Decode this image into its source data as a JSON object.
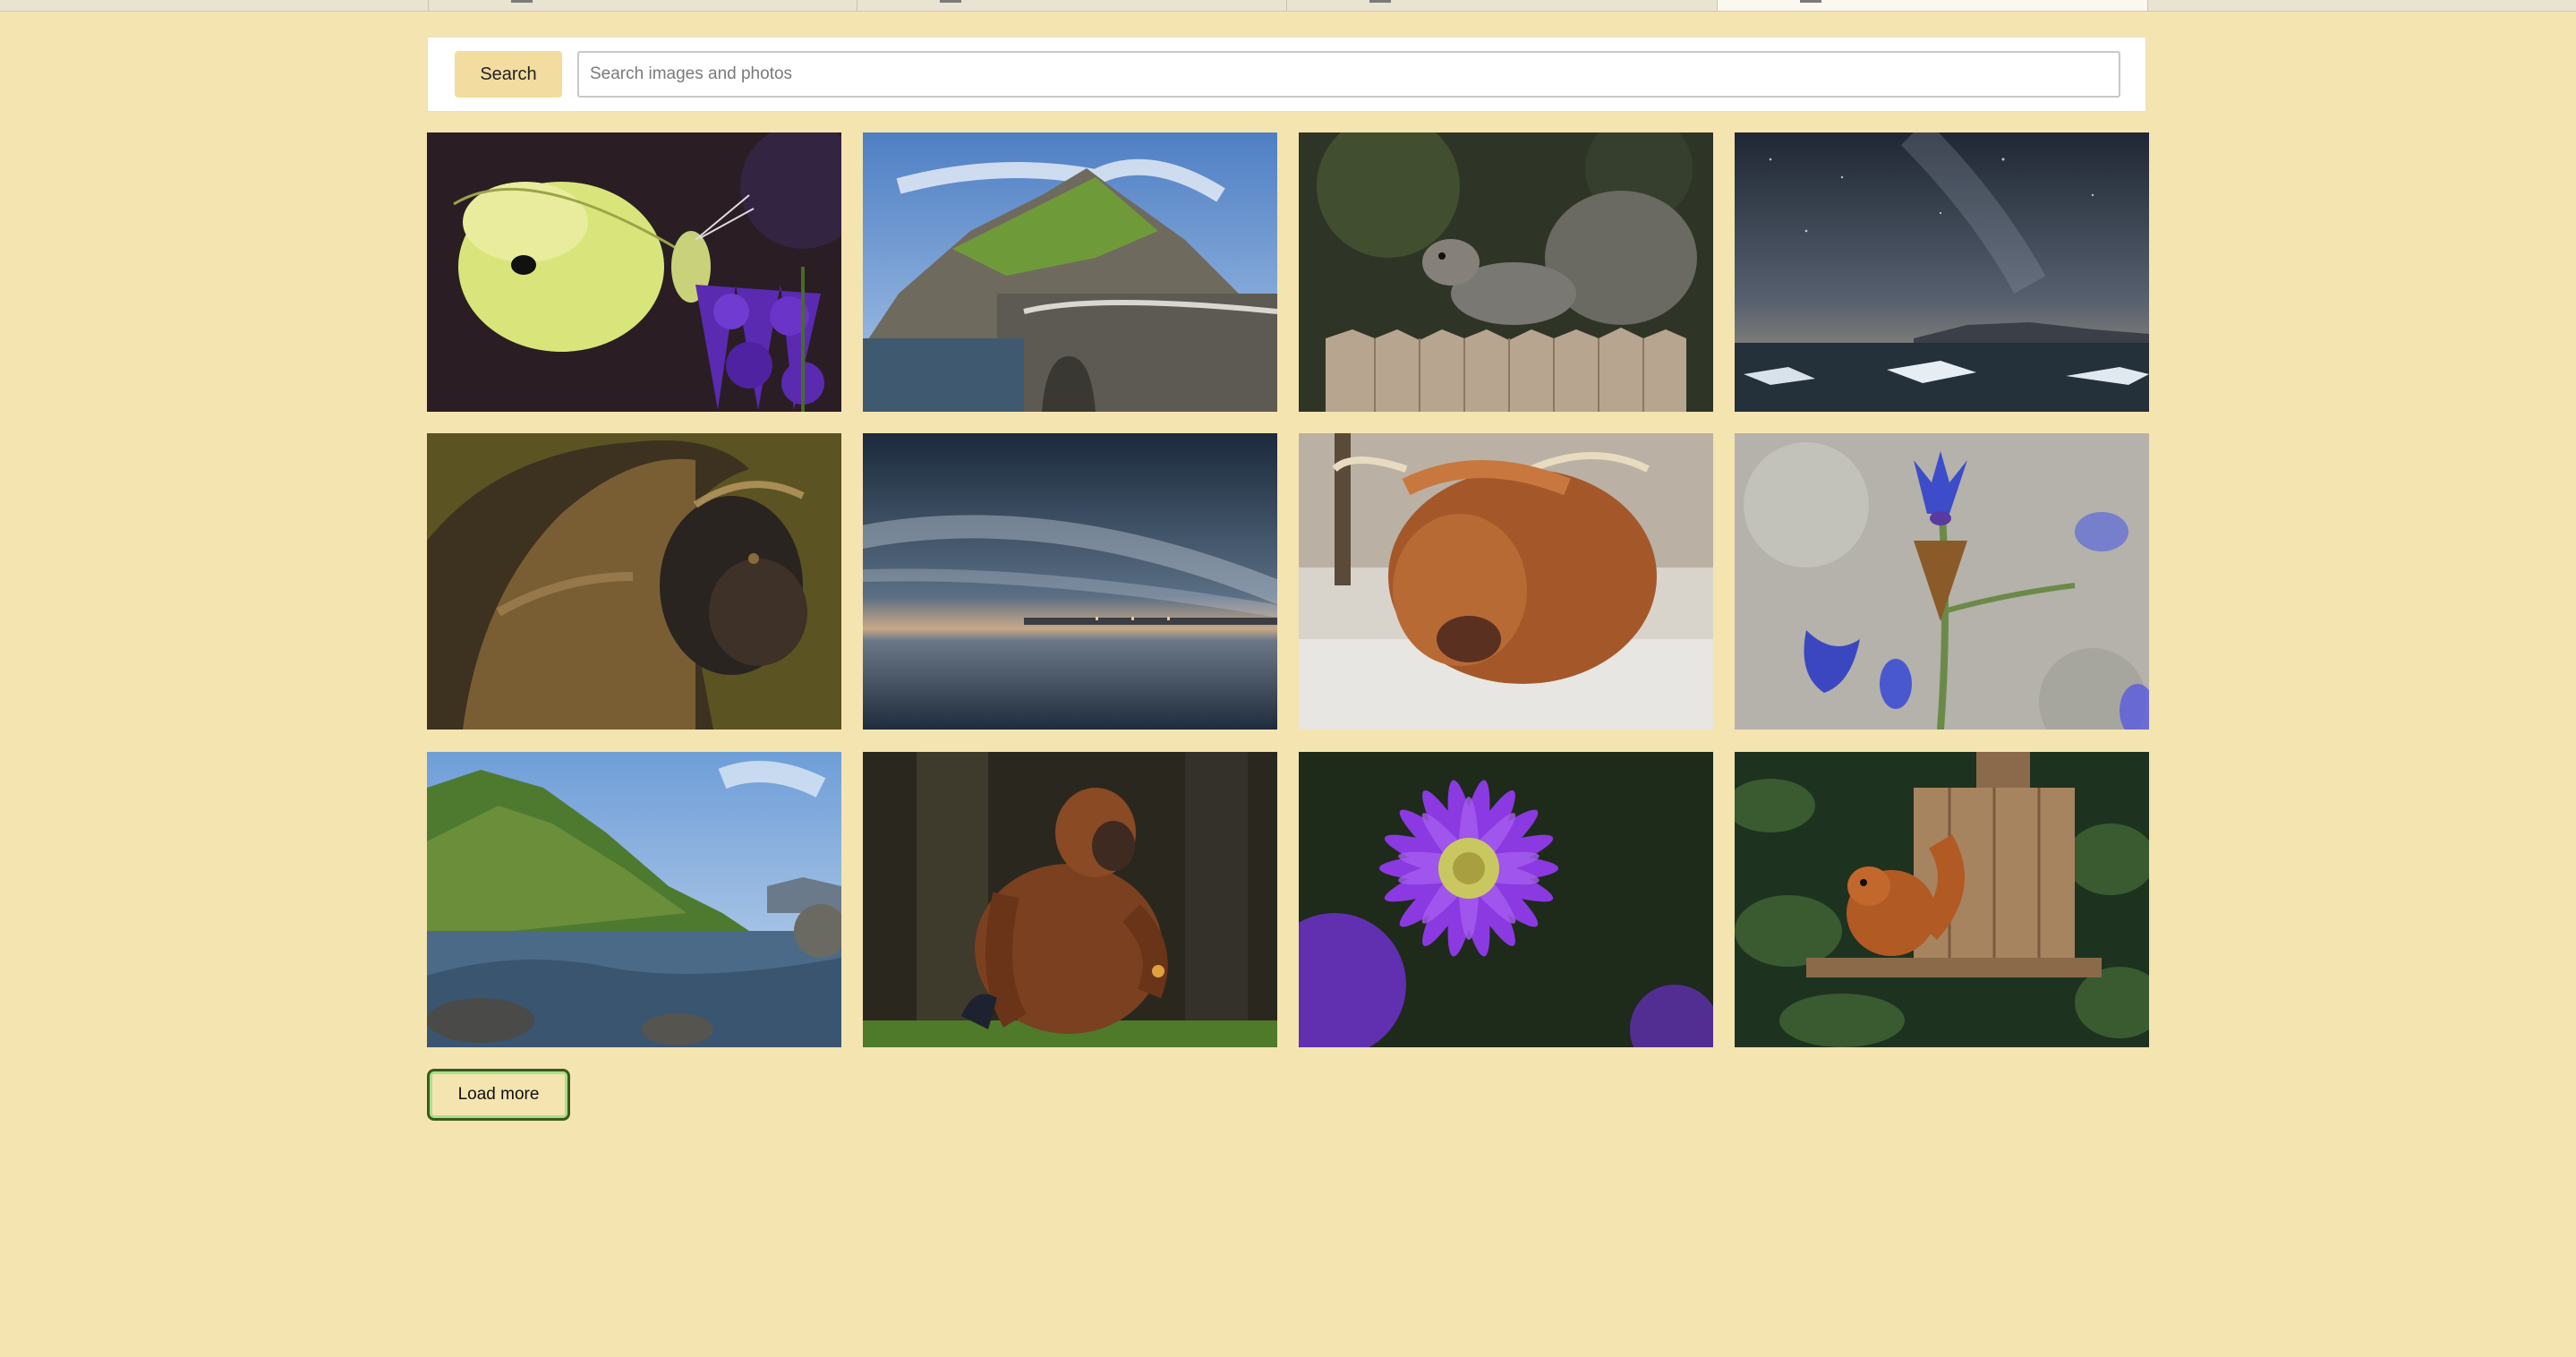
{
  "search": {
    "button_label": "Search",
    "placeholder": "Search images and photos",
    "value": ""
  },
  "gallery": {
    "images": [
      {
        "name": "butterfly-on-lavender-image"
      },
      {
        "name": "coastal-island-path-image"
      },
      {
        "name": "squirrel-on-fence-image"
      },
      {
        "name": "night-sky-lake-ice-image"
      },
      {
        "name": "gelada-monkey-image"
      },
      {
        "name": "calm-sea-horizon-image"
      },
      {
        "name": "highland-cow-image"
      },
      {
        "name": "moth-on-blue-flower-image"
      },
      {
        "name": "green-coastal-cliffs-image"
      },
      {
        "name": "orangutan-sitting-image"
      },
      {
        "name": "purple-aster-flower-image"
      },
      {
        "name": "red-squirrel-feeder-image"
      }
    ]
  },
  "load_more": {
    "label": "Load more"
  }
}
